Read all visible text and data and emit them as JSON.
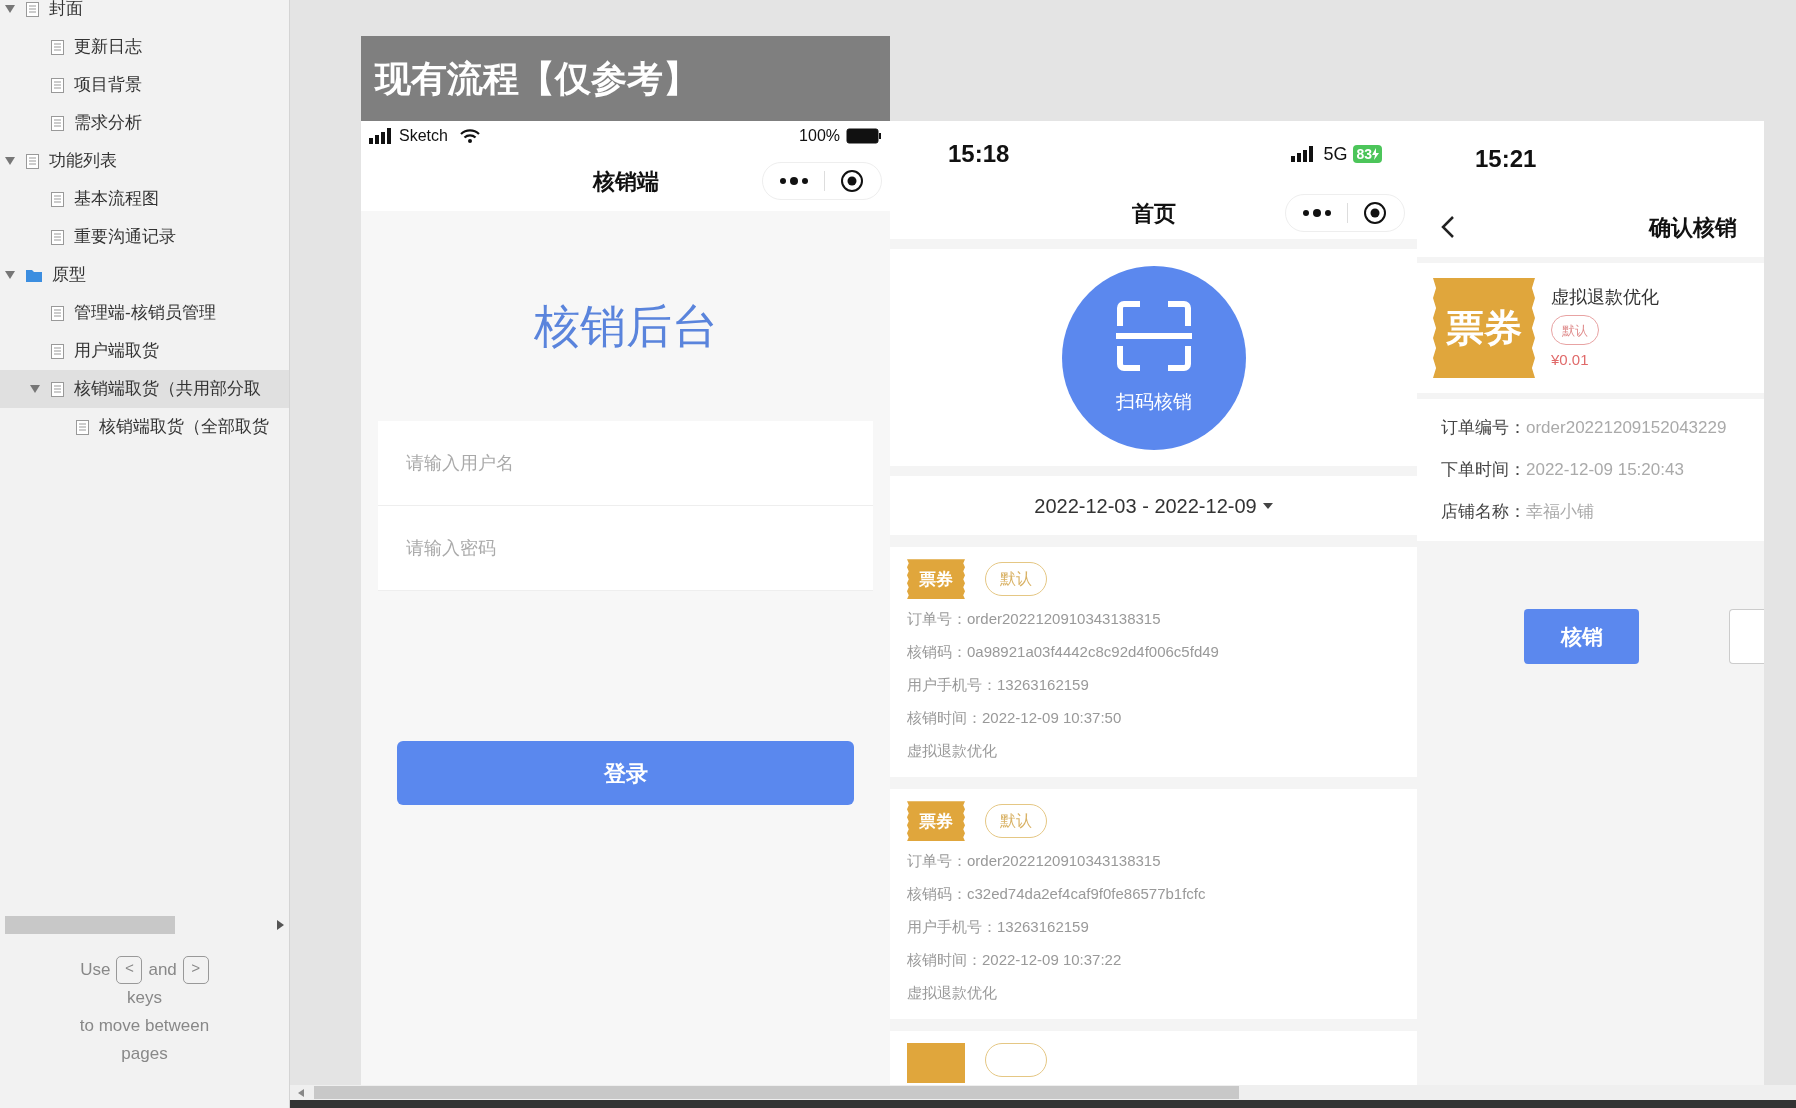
{
  "sidebar": {
    "tree": [
      {
        "label": "封面",
        "kind": "page",
        "expanded": true,
        "selected": false,
        "children": [
          {
            "label": "更新日志",
            "kind": "page",
            "selected": false
          },
          {
            "label": "项目背景",
            "kind": "page",
            "selected": false
          },
          {
            "label": "需求分析",
            "kind": "page",
            "selected": false
          }
        ]
      },
      {
        "label": "功能列表",
        "kind": "page",
        "expanded": true,
        "selected": false,
        "children": [
          {
            "label": "基本流程图",
            "kind": "page",
            "selected": false
          },
          {
            "label": "重要沟通记录",
            "kind": "page",
            "selected": false
          }
        ]
      },
      {
        "label": "原型",
        "kind": "folder",
        "expanded": true,
        "selected": false,
        "children": [
          {
            "label": "管理端-核销员管理",
            "kind": "page",
            "selected": false
          },
          {
            "label": "用户端取货",
            "kind": "page",
            "selected": false
          },
          {
            "label": "核销端取货（共用部分取",
            "kind": "page",
            "expanded": true,
            "selected": true,
            "children": [
              {
                "label": "核销端取货（全部取货",
                "kind": "page",
                "selected": false
              }
            ]
          }
        ]
      }
    ],
    "hint": {
      "before": "Use",
      "key_prev": "<",
      "middle": "and",
      "key_next": ">",
      "lines": [
        "keys",
        "to move between",
        "pages"
      ]
    }
  },
  "panel_title": "现有流程【仅参考】",
  "login_screen": {
    "status_bar": {
      "carrier": "Sketch",
      "battery": "100%"
    },
    "nav_title": "核销端",
    "heading": "核销后台",
    "fields": [
      {
        "placeholder": "请输入用户名"
      },
      {
        "placeholder": "请输入密码"
      }
    ],
    "button": "登录"
  },
  "home_screen": {
    "status_bar": {
      "time": "15:18",
      "network": "5G",
      "battery": "83"
    },
    "nav_title": "首页",
    "scan_label": "扫码核销",
    "date_range": "2022-12-03 - 2022-12-09",
    "records": [
      {
        "badge": "票券",
        "tag": "默认",
        "fields": [
          {
            "label": "订单号：",
            "value": "order2022120910343138315"
          },
          {
            "label": "核销码：",
            "value": "0a98921a03f4442c8c92d4f006c5fd49"
          },
          {
            "label": "用户手机号：",
            "value": "13263162159"
          },
          {
            "label": "核销时间：",
            "value": "2022-12-09 10:37:50"
          }
        ],
        "product": "虚拟退款优化"
      },
      {
        "badge": "票券",
        "tag": "默认",
        "fields": [
          {
            "label": "订单号：",
            "value": "order2022120910343138315"
          },
          {
            "label": "核销码：",
            "value": "c32ed74da2ef4caf9f0fe86577b1fcfc"
          },
          {
            "label": "用户手机号：",
            "value": "13263162159"
          },
          {
            "label": "核销时间：",
            "value": "2022-12-09 10:37:22"
          }
        ],
        "product": "虚拟退款优化"
      }
    ]
  },
  "confirm_screen": {
    "status_bar": {
      "time": "15:21"
    },
    "nav_title": "确认核销",
    "product": {
      "badge": "票券",
      "name": "虚拟退款优化",
      "tag": "默认",
      "price": "¥0.01"
    },
    "details": [
      {
        "label": "订单编号：",
        "value": "order20221209152043229"
      },
      {
        "label": "下单时间：",
        "value": "2022-12-09 15:20:43"
      },
      {
        "label": "店铺名称：",
        "value": "幸福小铺"
      }
    ],
    "button": "核销"
  }
}
